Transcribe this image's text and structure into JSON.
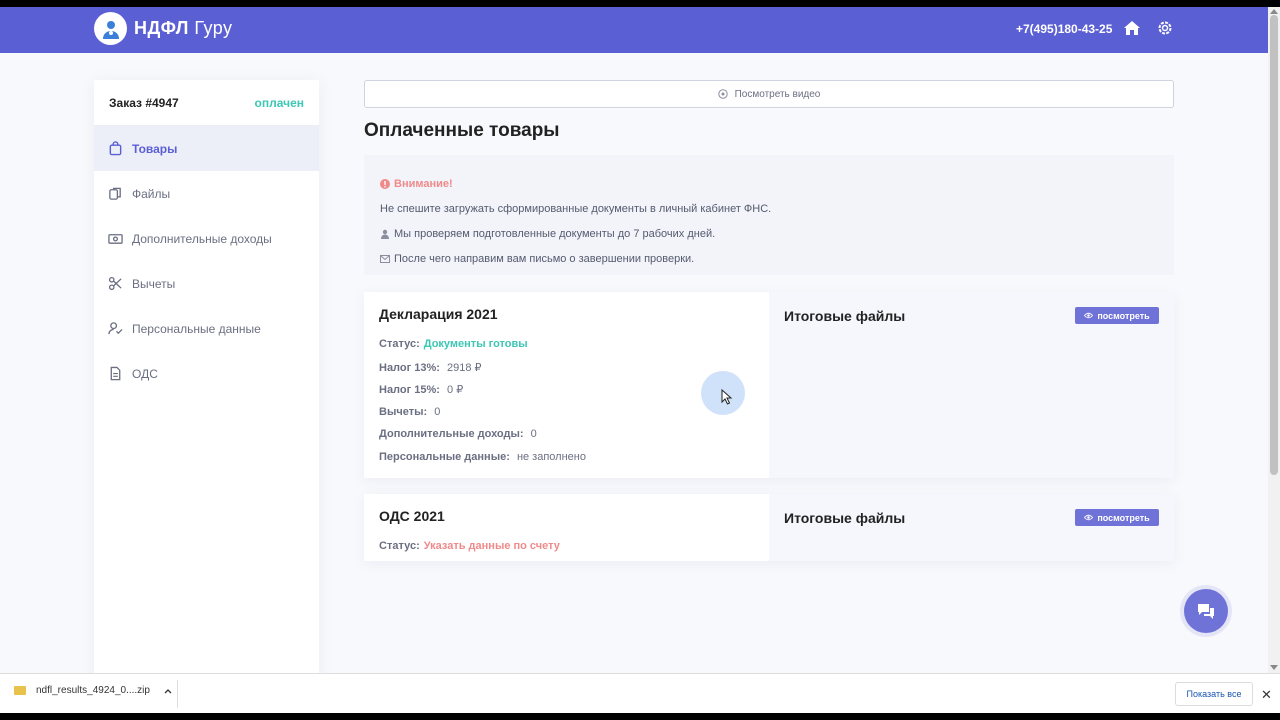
{
  "header": {
    "brand_bold": "НДФЛ",
    "brand_light": " Гуру",
    "phone": "+7(495)180-43-25",
    "color": "#5b5fd4"
  },
  "sidebar": {
    "order_title": "Заказ #4947",
    "order_status": "оплачен",
    "items": [
      {
        "label": "Товары",
        "icon": "bag-icon",
        "active": true
      },
      {
        "label": "Файлы",
        "icon": "files-icon"
      },
      {
        "label": "Дополнительные доходы",
        "icon": "cash-icon"
      },
      {
        "label": "Вычеты",
        "icon": "scissors-icon"
      },
      {
        "label": "Персональные данные",
        "icon": "user-check-icon"
      },
      {
        "label": "ОДС",
        "icon": "document-icon"
      }
    ]
  },
  "main": {
    "video_button": "Посмотреть видео",
    "page_title": "Оплаченные товары",
    "notice": {
      "warning": "Внимание!",
      "line1": "Не спешите загружать сформированные документы в личный кабинет ФНС.",
      "line2": "Мы проверяем подготовленные документы до 7 рабочих дней.",
      "line3": "После чего направим вам письмо о завершении проверки."
    },
    "cards": [
      {
        "title": "Декларация 2021",
        "status_key": "Статус:",
        "status_value": "Документы готовы",
        "fields": [
          {
            "key": "Налог 13%:",
            "value": "2918 ₽"
          },
          {
            "key": "Налог 15%:",
            "value": "0 ₽"
          },
          {
            "key": "Вычеты:",
            "value": "0"
          },
          {
            "key": "Дополнительные доходы:",
            "value": "0"
          },
          {
            "key": "Персональные данные:",
            "value": "не заполнено"
          }
        ],
        "files_title": "Итоговые файлы",
        "view_label": "посмотреть"
      },
      {
        "title": "ОДС 2021",
        "status_key": "Статус:",
        "status_value": "Указать данные по счету",
        "files_title": "Итоговые файлы",
        "view_label": "посмотреть"
      }
    ]
  },
  "downloads": {
    "file": "ndfl_results_4924_0....zip",
    "show_all": "Показать все",
    "close": "✕"
  }
}
